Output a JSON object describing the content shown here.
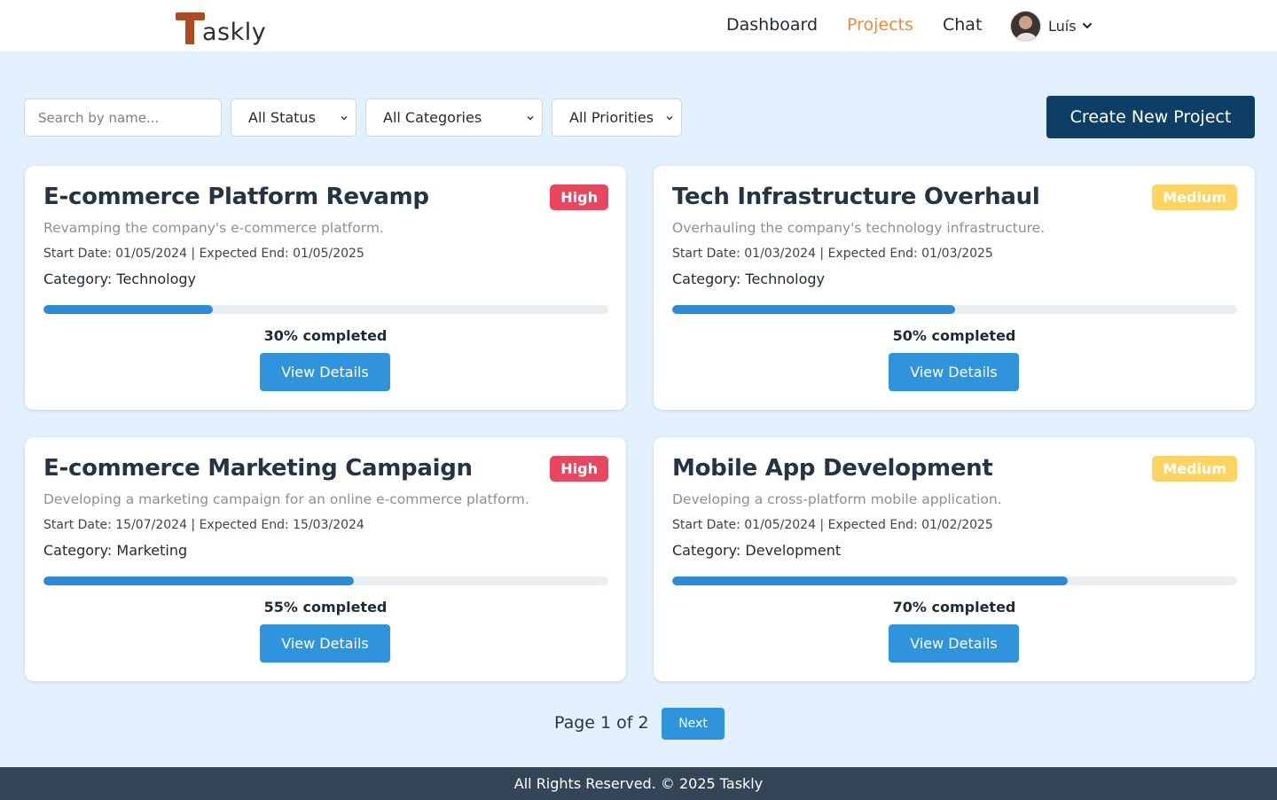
{
  "app": {
    "logo_letter": "T",
    "logo_rest": "askly"
  },
  "nav": {
    "dashboard": "Dashboard",
    "projects": "Projects",
    "chat": "Chat",
    "user_name": "Luís",
    "active_color": "#f0893a"
  },
  "filters": {
    "search_placeholder": "Search by name...",
    "status": "All Status",
    "categories": "All Categories",
    "priorities": "All Priorities",
    "create_label": "Create New Project"
  },
  "projects": [
    {
      "title": "E-commerce Platform Revamp",
      "priority": "High",
      "description": "Revamping the company's e-commerce platform.",
      "dates": "Start Date: 01/05/2024 | Expected End: 01/05/2025",
      "category": "Category: Technology",
      "progress": 30,
      "progress_label": "30% completed",
      "button": "View Details"
    },
    {
      "title": "Tech Infrastructure Overhaul",
      "priority": "Medium",
      "description": "Overhauling the company's technology infrastructure.",
      "dates": "Start Date: 01/03/2024 | Expected End: 01/03/2025",
      "category": "Category: Technology",
      "progress": 50,
      "progress_label": "50% completed",
      "button": "View Details"
    },
    {
      "title": "E-commerce Marketing Campaign",
      "priority": "High",
      "description": "Developing a marketing campaign for an online e-commerce platform.",
      "dates": "Start Date: 15/07/2024 | Expected End: 15/03/2024",
      "category": "Category: Marketing",
      "progress": 55,
      "progress_label": "55% completed",
      "button": "View Details"
    },
    {
      "title": "Mobile App Development",
      "priority": "Medium",
      "description": "Developing a cross-platform mobile application.",
      "dates": "Start Date: 01/05/2024 | Expected End: 01/02/2025",
      "category": "Category: Development",
      "progress": 70,
      "progress_label": "70% completed",
      "button": "View Details"
    }
  ],
  "pagination": {
    "label": "Page 1 of 2",
    "next": "Next"
  },
  "footer": {
    "text": "All Rights Reserved. © 2025 Taskly"
  },
  "colors": {
    "primary_dark": "#0d3f66",
    "primary": "#3094dc",
    "high": "#e8475f",
    "medium": "#fdd464",
    "background": "#e3f0fd",
    "footer": "#344558"
  }
}
